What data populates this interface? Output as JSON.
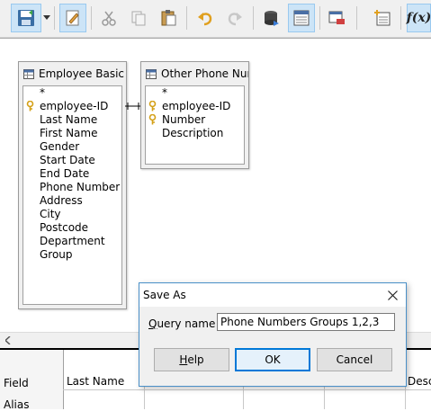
{
  "toolbar": {
    "buttons": [
      {
        "name": "save-icon"
      },
      {
        "name": "edit-mode-icon"
      },
      {
        "name": "cut-icon"
      },
      {
        "name": "copy-icon"
      },
      {
        "name": "paste-icon"
      },
      {
        "name": "undo-icon"
      },
      {
        "name": "redo-icon"
      },
      {
        "name": "run-query-icon"
      },
      {
        "name": "design-view-icon"
      },
      {
        "name": "clear-query-icon"
      },
      {
        "name": "add-tables-icon"
      },
      {
        "name": "functions-icon"
      }
    ],
    "functions_label": "f(x)"
  },
  "tables": [
    {
      "title": "Employee Basic Details",
      "fields": [
        {
          "label": "*",
          "key": false
        },
        {
          "label": "employee-ID",
          "key": true
        },
        {
          "label": "Last Name",
          "key": false
        },
        {
          "label": "First Name",
          "key": false
        },
        {
          "label": "Gender",
          "key": false
        },
        {
          "label": "Start Date",
          "key": false
        },
        {
          "label": "End Date",
          "key": false
        },
        {
          "label": "Phone Number",
          "key": false
        },
        {
          "label": "Address",
          "key": false
        },
        {
          "label": "City",
          "key": false
        },
        {
          "label": "Postcode",
          "key": false
        },
        {
          "label": "Department",
          "key": false
        },
        {
          "label": "Group",
          "key": false
        }
      ]
    },
    {
      "title": "Other Phone Numbers",
      "fields": [
        {
          "label": "*",
          "key": false
        },
        {
          "label": "employee-ID",
          "key": true
        },
        {
          "label": "Number",
          "key": true
        },
        {
          "label": "Description",
          "key": false
        }
      ]
    }
  ],
  "grid": {
    "row_labels": [
      "Field",
      "Alias"
    ],
    "cells": {
      "col1_field": "Last Name",
      "col5_field": "Descr"
    }
  },
  "dialog": {
    "title": "Save As",
    "label_prefix": "Q",
    "label_rest": "uery name",
    "input_value": "Phone Numbers Groups 1,2,3",
    "help_prefix": "H",
    "help_rest": "elp",
    "ok_label": "OK",
    "cancel_label": "Cancel"
  },
  "colors": {
    "accent": "#0078d7",
    "key_icon": "#d4a017",
    "toolbar_bg": "#f0f0f0"
  }
}
